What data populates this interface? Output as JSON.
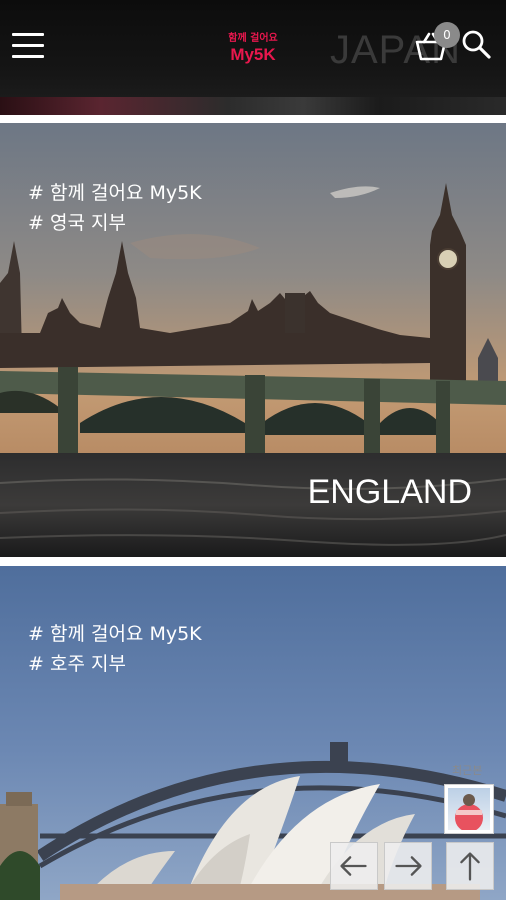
{
  "header": {
    "logo_line1": "함께 걸어요",
    "logo_line2": "My5K",
    "background_word": "JAPAN",
    "cart_count": "0",
    "accent_color": "#e8174d"
  },
  "cards": [
    {
      "tag1": "# 함께 걸어요 My5K",
      "tag2": "# 영국 지부",
      "country_label": "ENGLAND"
    },
    {
      "tag1": "# 함께 걸어요 My5K",
      "tag2": "# 호주 지부"
    }
  ],
  "floating": {
    "recent_label": "최근본",
    "icons": [
      "arrow-left-icon",
      "arrow-right-icon",
      "arrow-up-icon"
    ]
  }
}
